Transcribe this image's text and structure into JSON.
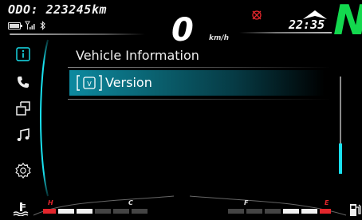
{
  "top": {
    "odometer": "ODO: 223245km",
    "speed": "0",
    "speed_unit": "km/h",
    "time": "22:35",
    "gear": "N"
  },
  "icons": {
    "warning": "abs-warning-icon",
    "direction": "direction-chevron-icon"
  },
  "sidebar": {
    "items": [
      {
        "name": "info-icon",
        "active": true
      },
      {
        "name": "phone-icon",
        "active": false
      },
      {
        "name": "connection-icon",
        "active": false
      },
      {
        "name": "music-icon",
        "active": false
      },
      {
        "name": "settings-icon",
        "active": false
      }
    ]
  },
  "menu": {
    "title": "Vehicle Information",
    "items": [
      {
        "label": "Version",
        "selected": true
      }
    ]
  },
  "gauges": {
    "temp": {
      "low": "C",
      "high": "H"
    },
    "fuel": {
      "low": "E",
      "high": "F"
    }
  },
  "colors": {
    "accent": "#19e0ee",
    "gear": "#13d84e",
    "warning": "#e3262c",
    "selection": "#0d8aa0"
  }
}
